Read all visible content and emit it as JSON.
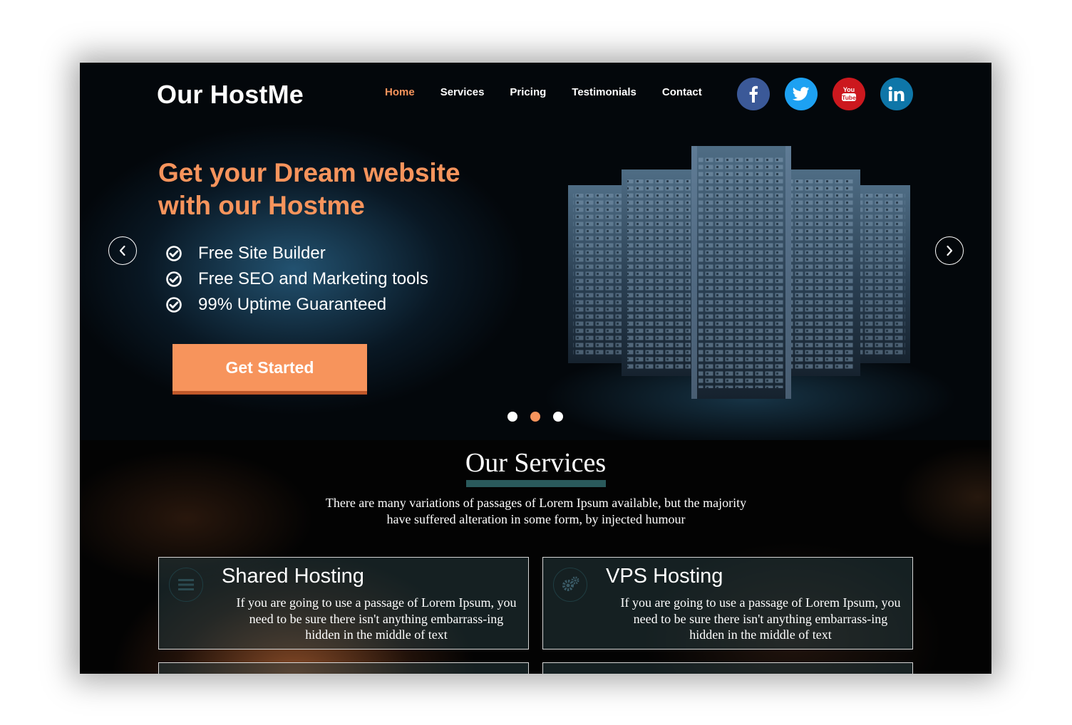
{
  "brand": {
    "name": "Our HostMe"
  },
  "nav": {
    "items": [
      {
        "label": "Home",
        "active": true
      },
      {
        "label": "Services",
        "active": false
      },
      {
        "label": "Pricing",
        "active": false
      },
      {
        "label": "Testimonials",
        "active": false
      },
      {
        "label": "Contact",
        "active": false
      }
    ]
  },
  "social": [
    {
      "name": "facebook-icon",
      "color": "#3b5998"
    },
    {
      "name": "twitter-icon",
      "color": "#1da1f2"
    },
    {
      "name": "youtube-icon",
      "color": "#cc181e"
    },
    {
      "name": "linkedin-icon",
      "color": "#0e76a8"
    }
  ],
  "hero": {
    "headline_line1": "Get your Dream website",
    "headline_line2": "with our Hostme",
    "features": [
      "Free Site Builder",
      "Free SEO and Marketing tools",
      "99% Uptime Guaranteed"
    ],
    "cta_label": "Get Started",
    "slides": {
      "count": 3,
      "active_index": 1
    }
  },
  "services": {
    "title": "Our Services",
    "description": "There are many variations of passages of Lorem Ipsum available, but the majority have suffered alteration in some form, by injected humour",
    "cards": [
      {
        "title": "Shared Hosting",
        "icon": "menu-icon",
        "text": "If you are going to use a passage of Lorem Ipsum, you need to be sure there isn't anything embarrass-ing hidden in the middle of text"
      },
      {
        "title": "VPS Hosting",
        "icon": "gears-icon",
        "text": "If you are going to use a passage of Lorem Ipsum, you need to be sure there isn't anything embarrass-ing hidden in the middle of text"
      }
    ]
  },
  "colors": {
    "accent": "#f7945c",
    "underline": "#2a5a5c",
    "background": "#000000"
  }
}
